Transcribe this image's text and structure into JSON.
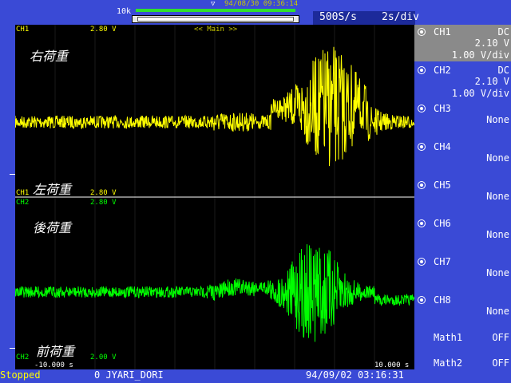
{
  "header": {
    "record_length": "10k",
    "trigger_marker": "▽",
    "top_date": "94/08/30 09:36:14",
    "sample_rate": "500S/s",
    "time_div": "2s/div"
  },
  "plot": {
    "view_label": "<< Main >>",
    "upper": {
      "ch_label": "CH1",
      "level": "2.80 V",
      "title_top": "右荷重",
      "title_bottom": "左荷重",
      "bottom_ch_label": "CH1",
      "bottom_level": "2.80 V"
    },
    "lower": {
      "ch_label": "CH2",
      "level": "2.80 V",
      "title_top": "後荷重",
      "title_bottom": "前荷重",
      "bottom_ch_label": "CH2",
      "bottom_level": "2.00 V"
    },
    "time_left": "-10.000 s",
    "time_right": "10.000 s",
    "colors": {
      "ch1": "#ffff00",
      "ch2": "#00ff00",
      "background": "#000000",
      "divider": "#ffffff"
    }
  },
  "channels": [
    {
      "name": "CH1",
      "coupling": "DC",
      "offset": "2.10 V",
      "scale": "1.00 V/div",
      "active": true
    },
    {
      "name": "CH2",
      "coupling": "DC",
      "offset": "2.10 V",
      "scale": "1.00 V/div",
      "active": false
    },
    {
      "name": "CH3",
      "state": "None"
    },
    {
      "name": "CH4",
      "state": "None"
    },
    {
      "name": "CH5",
      "state": "None"
    },
    {
      "name": "CH6",
      "state": "None"
    },
    {
      "name": "CH7",
      "state": "None"
    },
    {
      "name": "CH8",
      "state": "None"
    }
  ],
  "math": [
    {
      "name": "Math1",
      "state": "OFF"
    },
    {
      "name": "Math2",
      "state": "OFF"
    }
  ],
  "footer": {
    "status": "Stopped",
    "file": "0 JYARI_DORI",
    "datetime": "94/09/02 03:16:31"
  }
}
